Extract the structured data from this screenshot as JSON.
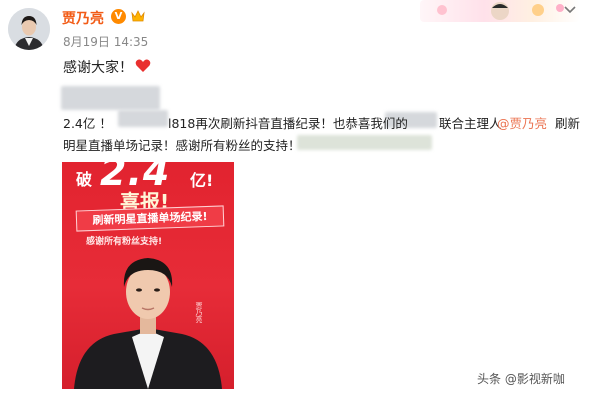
{
  "post": {
    "author": "贾乃亮",
    "verified_badge": "V",
    "time": "8月19日 14:35",
    "text": "感谢大家！",
    "body_line1_a": "2.4亿 ！",
    "body_line1_b": "l818再次刷新抖音直播纪录！也恭喜我们的",
    "body_line1_c": "联合主理人",
    "body_mention": "@贾乃亮",
    "body_line1_d": "刷新",
    "body_line2": "明星直播单场记录！感谢所有粉丝的支持！"
  },
  "poster": {
    "top_text": "破",
    "big_number": "2.4",
    "unit": "亿!",
    "headline": "喜报!",
    "banner": "刷新明星直播单场纪录!",
    "subline": "感谢所有粉丝支持!",
    "vertical_name": "贾乃亮"
  },
  "watermark": "头条 @影视新咖",
  "colors": {
    "name": "#f25c17",
    "mention": "#eb7350",
    "poster_red": "#e2232f"
  }
}
